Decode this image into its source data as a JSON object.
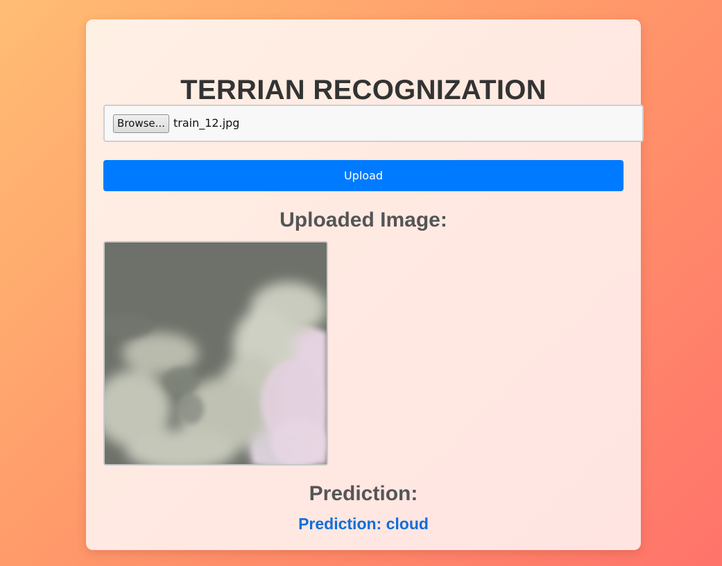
{
  "page": {
    "title": "TERRIAN RECOGNIZATION"
  },
  "file_input": {
    "browse_label": "Browse...",
    "file_name": "train_12.jpg"
  },
  "upload_button": {
    "label": "Upload"
  },
  "uploaded_section": {
    "heading": "Uploaded Image:",
    "image_subject": "cloud-satellite-image"
  },
  "prediction_section": {
    "heading": "Prediction:",
    "result_text": "Prediction: cloud"
  },
  "colors": {
    "accent": "#007bff",
    "prediction_text": "#0d6fd9",
    "heading_dark": "#333333",
    "heading_gray": "#555555"
  }
}
